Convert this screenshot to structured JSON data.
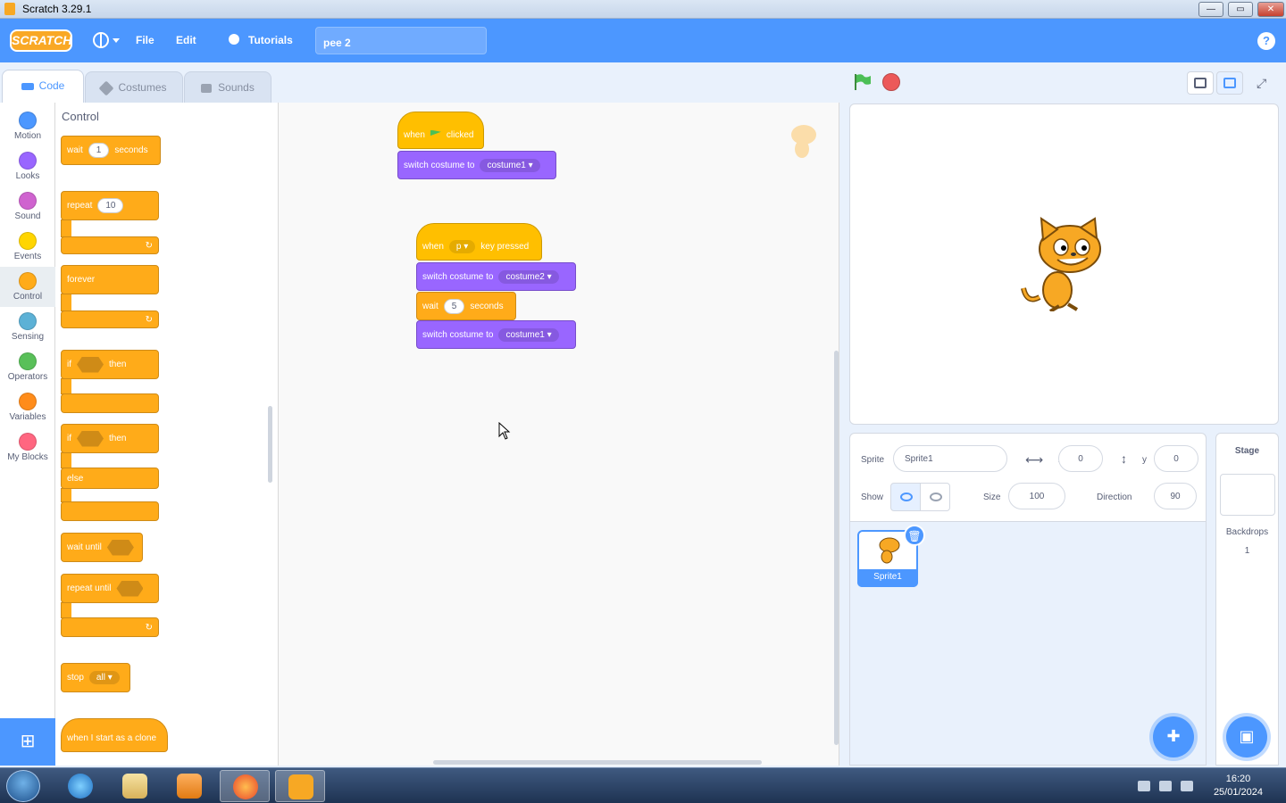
{
  "window": {
    "title": "Scratch 3.29.1",
    "minimize": "—",
    "maximize": "▭",
    "close": "✕"
  },
  "menubar": {
    "logo": "SCRATCH",
    "file": "File",
    "edit": "Edit",
    "tutorials": "Tutorials",
    "project_name": "pee 2",
    "help": "?"
  },
  "tabs": [
    {
      "label": "Code"
    },
    {
      "label": "Costumes"
    },
    {
      "label": "Sounds"
    }
  ],
  "categories": [
    {
      "label": "Motion",
      "color": "#4c97ff"
    },
    {
      "label": "Looks",
      "color": "#9966ff"
    },
    {
      "label": "Sound",
      "color": "#cf63cf"
    },
    {
      "label": "Events",
      "color": "#ffd500"
    },
    {
      "label": "Control",
      "color": "#ffab19"
    },
    {
      "label": "Sensing",
      "color": "#5cb1d6"
    },
    {
      "label": "Operators",
      "color": "#59c059"
    },
    {
      "label": "Variables",
      "color": "#ff8c1a"
    },
    {
      "label": "My Blocks",
      "color": "#ff6680"
    }
  ],
  "palette": {
    "title": "Control",
    "wait": {
      "label": "wait",
      "value": "1",
      "unit": "seconds"
    },
    "repeat": {
      "label": "repeat",
      "value": "10"
    },
    "forever": {
      "label": "forever"
    },
    "if_then": {
      "if": "if",
      "then": "then"
    },
    "if_else": {
      "if": "if",
      "then": "then",
      "else": "else"
    },
    "wait_until": {
      "label": "wait until"
    },
    "repeat_until": {
      "label": "repeat until"
    },
    "stop": {
      "label": "stop",
      "option": "all"
    },
    "clone": {
      "label": "when I start as a clone"
    }
  },
  "scripts": {
    "s1": {
      "when": "when",
      "clicked": "clicked",
      "switch": "switch costume to",
      "costume": "costume1"
    },
    "s2": {
      "when": "when",
      "key": "p",
      "pressed": "key pressed",
      "switch1": "switch costume to",
      "costume1": "costume2",
      "wait": "wait",
      "wait_val": "5",
      "seconds": "seconds",
      "switch2": "switch costume to",
      "costume2": "costume1"
    }
  },
  "zoom": {
    "in": "+",
    "out": "−",
    "reset": "="
  },
  "sprite_info": {
    "sprite_label": "Sprite",
    "sprite_name": "Sprite1",
    "x_label": "x",
    "x_value": "0",
    "y_label": "y",
    "y_value": "0",
    "show_label": "Show",
    "size_label": "Size",
    "size_value": "100",
    "direction_label": "Direction",
    "direction_value": "90"
  },
  "sprites": [
    {
      "name": "Sprite1"
    }
  ],
  "stage_pane": {
    "title": "Stage",
    "backdrops_label": "Backdrops",
    "backdrops_count": "1"
  },
  "taskbar": {
    "time": "16:20",
    "date": "25/01/2024"
  }
}
